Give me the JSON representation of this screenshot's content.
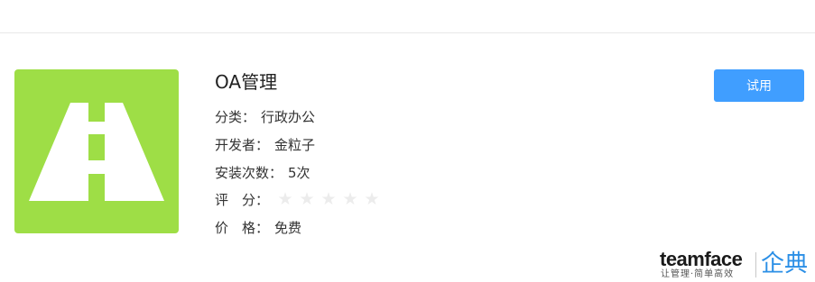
{
  "app": {
    "name": "OA管理",
    "icon": "road-icon",
    "icon_color": "#9ede46",
    "category": {
      "label": "分类：",
      "value": "行政办公"
    },
    "developer": {
      "label": "开发者：",
      "value": "金粒子"
    },
    "installs": {
      "label": "安装次数：",
      "value": "5次"
    },
    "rating": {
      "label": "评　分：",
      "stars_total": 5,
      "stars_filled": 0
    },
    "price": {
      "label": "价　格：",
      "value": "免费"
    }
  },
  "actions": {
    "try_label": "试用",
    "try_color": "#409eff"
  },
  "brand": {
    "name_en": "teamface",
    "tagline": "让管理·简单高效",
    "name_cn": "企典",
    "color_cn": "#2b8fe6"
  }
}
